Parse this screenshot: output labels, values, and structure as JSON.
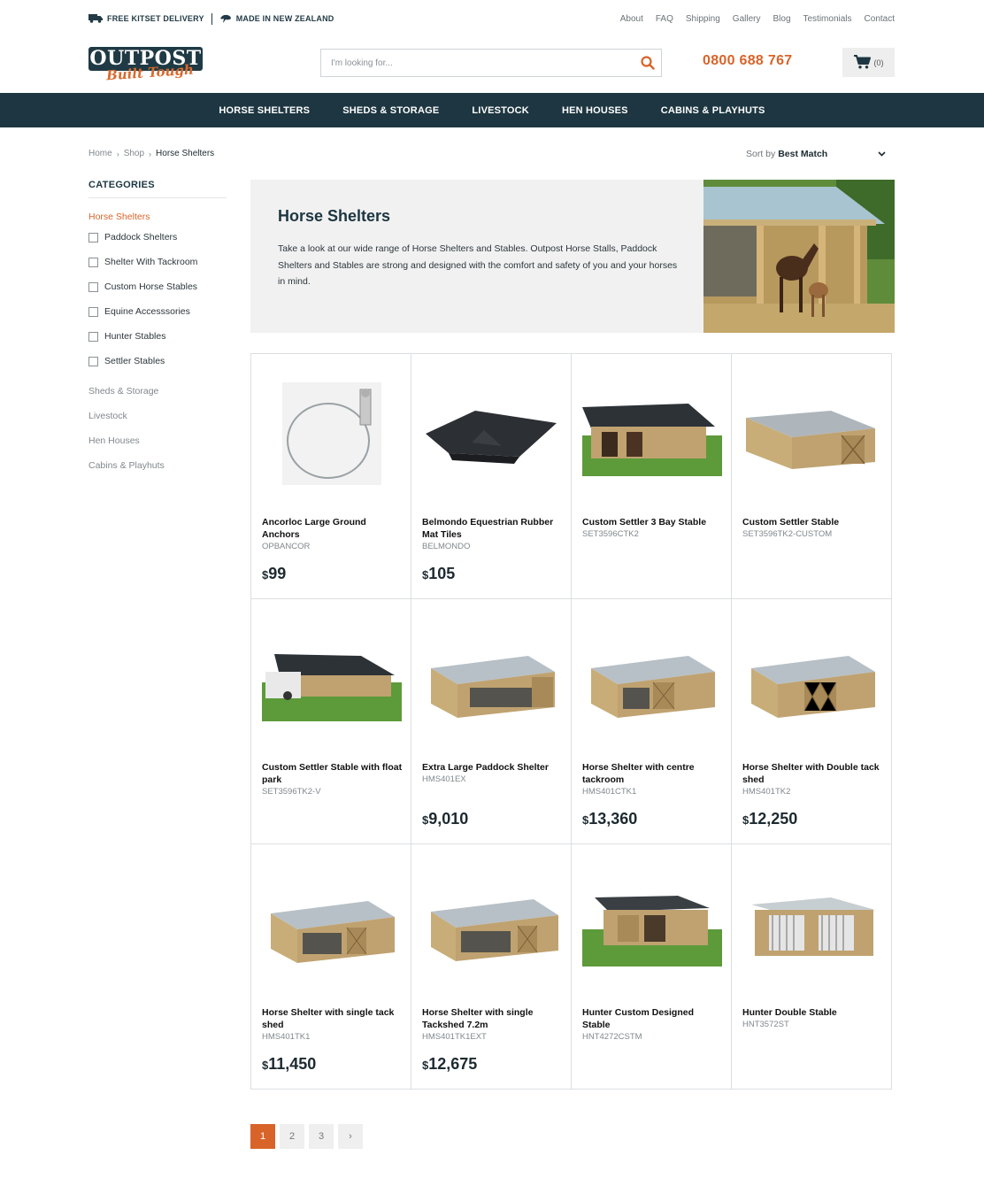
{
  "topbar": {
    "delivery": "FREE KITSET DELIVERY",
    "made_in": "MADE IN NEW ZEALAND",
    "links": [
      "About",
      "FAQ",
      "Shipping",
      "Gallery",
      "Blog",
      "Testimonials",
      "Contact"
    ]
  },
  "header": {
    "logo_word": "OUTPOST",
    "logo_tag": "Built Tough",
    "search_placeholder": "I'm looking for...",
    "phone": "0800 688 767",
    "cart_count": "(0)"
  },
  "nav": [
    "HORSE SHELTERS",
    "SHEDS & STORAGE",
    "LIVESTOCK",
    "HEN HOUSES",
    "CABINS & PLAYHUTS"
  ],
  "breadcrumb": {
    "home": "Home",
    "shop": "Shop",
    "current": "Horse Shelters"
  },
  "sort": {
    "prefix": "Sort by",
    "value": "Best Match"
  },
  "sidebar": {
    "title": "CATEGORIES",
    "active": "Horse Shelters",
    "subcategories": [
      "Paddock Shelters",
      "Shelter With Tackroom",
      "Custom Horse Stables",
      "Equine Accesssories",
      "Hunter Stables",
      "Settler Stables"
    ],
    "categories": [
      "Sheds & Storage",
      "Livestock",
      "Hen Houses",
      "Cabins & Playhuts"
    ]
  },
  "hero": {
    "title": "Horse Shelters",
    "description": "Take a look at our wide range of Horse Shelters and Stables. Outpost Horse Stalls, Paddock Shelters and Stables are strong and designed with the comfort and safety of you and your horses in mind."
  },
  "currency": "$",
  "products": [
    {
      "name": "Ancorloc Large Ground Anchors",
      "sku": "OPBANCOR",
      "price": "99",
      "img": "anchor-image"
    },
    {
      "name": "Belmondo Equestrian Rubber Mat Tiles",
      "sku": "BELMONDO",
      "price": "105",
      "img": "mat-image"
    },
    {
      "name": "Custom Settler 3 Bay Stable",
      "sku": "SET3596CTK2",
      "price": "",
      "img": "stable-green-image"
    },
    {
      "name": "Custom Settler Stable",
      "sku": "SET3596TK2-CUSTOM",
      "price": "",
      "img": "shed-closed-image"
    },
    {
      "name": "Custom Settler Stable with float park",
      "sku": "SET3596TK2-V",
      "price": "",
      "img": "stable-float-image"
    },
    {
      "name": "Extra Large Paddock Shelter",
      "sku": "HMS401EX",
      "price": "9,010",
      "img": "shelter-open-image"
    },
    {
      "name": "Horse Shelter with centre tackroom",
      "sku": "HMS401CTK1",
      "price": "13,360",
      "img": "shelter-centre-image"
    },
    {
      "name": "Horse Shelter with Double tack shed",
      "sku": "HMS401TK2",
      "price": "12,250",
      "img": "shelter-double-image"
    },
    {
      "name": "Horse Shelter with single tack shed",
      "sku": "HMS401TK1",
      "price": "11,450",
      "img": "shelter-single-image"
    },
    {
      "name": "Horse Shelter with single Tackshed 7.2m",
      "sku": "HMS401TK1EXT",
      "price": "12,675",
      "img": "shelter-single-ext-image"
    },
    {
      "name": "Hunter Custom Designed Stable",
      "sku": "HNT4272CSTM",
      "price": "",
      "img": "hunter-green-image"
    },
    {
      "name": "Hunter Double Stable",
      "sku": "HNT3572ST",
      "price": "",
      "img": "hunter-double-image"
    }
  ],
  "pagination": [
    "1",
    "2",
    "3",
    "›"
  ],
  "colors": {
    "accent": "#d8642a",
    "nav_bg": "#1d3641",
    "hero_bg": "#f1f1f1"
  }
}
